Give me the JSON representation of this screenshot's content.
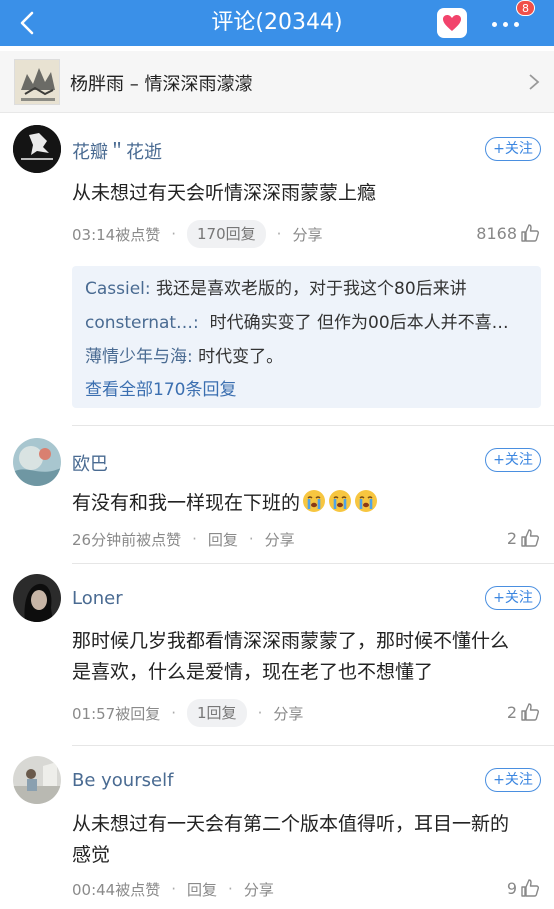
{
  "header": {
    "title": "评论(20344)",
    "badge": "8",
    "accent": "#3a90e8"
  },
  "song": {
    "title": "杨胖雨 – 情深深雨濛濛"
  },
  "comments": [
    {
      "user": "花瓣＂花逝",
      "follow": "+关注",
      "text": "从未想过有天会听情深深雨蒙蒙上瘾",
      "time": "03:14被点赞",
      "reply": "170回复",
      "share": "分享",
      "likes": "8168",
      "replies": [
        {
          "name": "Cassiel:",
          "text": "我还是喜欢老版的，对于我这个80后来讲"
        },
        {
          "name": "consternat…:",
          "text": "时代确实变了  但作为00后本人并不喜…"
        },
        {
          "name": "薄情少年与海:",
          "text": "时代变了。"
        }
      ],
      "view_all": "查看全部170条回复"
    },
    {
      "user": "欧巴",
      "follow": "+关注",
      "text": "有没有和我一样现在下班的",
      "time": "26分钟前被点赞",
      "reply": "回复",
      "share": "分享",
      "likes": "2"
    },
    {
      "user": "Loner",
      "follow": "+关注",
      "text_line1": "那时候几岁我都看情深深雨蒙蒙了，那时候不懂什么",
      "text_line2": "是喜欢，什么是爱情，现在老了也不想懂了",
      "time": "01:57被回复",
      "reply": "1回复",
      "share": "分享",
      "likes": "2"
    },
    {
      "user": "Be yourself",
      "follow": "+关注",
      "text_line1": "从未想过有一天会有第二个版本值得听，耳目一新的",
      "text_line2": "感觉",
      "time": "00:44被点赞",
      "reply": "回复",
      "share": "分享",
      "likes": "9"
    }
  ],
  "icons": [
    "back-arrow-icon",
    "heart-icon",
    "more-icon",
    "chevron-right-icon",
    "thumbs-up-icon",
    "crying-emoji-icon"
  ]
}
